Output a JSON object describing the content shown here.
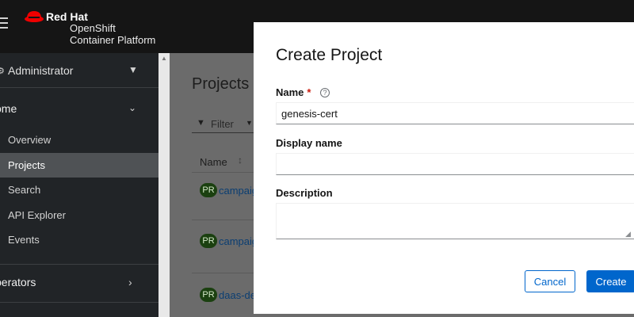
{
  "masthead": {
    "brand_line1": "Red Hat",
    "brand_line2": "OpenShift",
    "brand_line3": "Container Platform"
  },
  "sidebar": {
    "perspective": "Administrator",
    "home_section": "ome",
    "home_items": [
      "Overview",
      "Projects",
      "Search",
      "API Explorer",
      "Events"
    ],
    "active_item": "Projects",
    "operators_section": "perators"
  },
  "page": {
    "title": "Projects",
    "filter_label": "Filter",
    "column_name": "Name",
    "rows": [
      {
        "badge": "PR",
        "name": "campaig"
      },
      {
        "badge": "PR",
        "name": "campaig"
      },
      {
        "badge": "PR",
        "name": "daas-de"
      }
    ]
  },
  "modal": {
    "title": "Create Project",
    "name_label": "Name",
    "required_marker": "*",
    "name_value": "genesis-cert",
    "display_name_label": "Display name",
    "display_name_value": "",
    "description_label": "Description",
    "description_value": "",
    "cancel_label": "Cancel",
    "create_label": "Create"
  },
  "colors": {
    "masthead": "#151515",
    "sidebar": "#212427",
    "active_nav": "#4f5255",
    "primary": "#0066cc",
    "required": "#c9190b",
    "brand_red": "#ee0000"
  }
}
